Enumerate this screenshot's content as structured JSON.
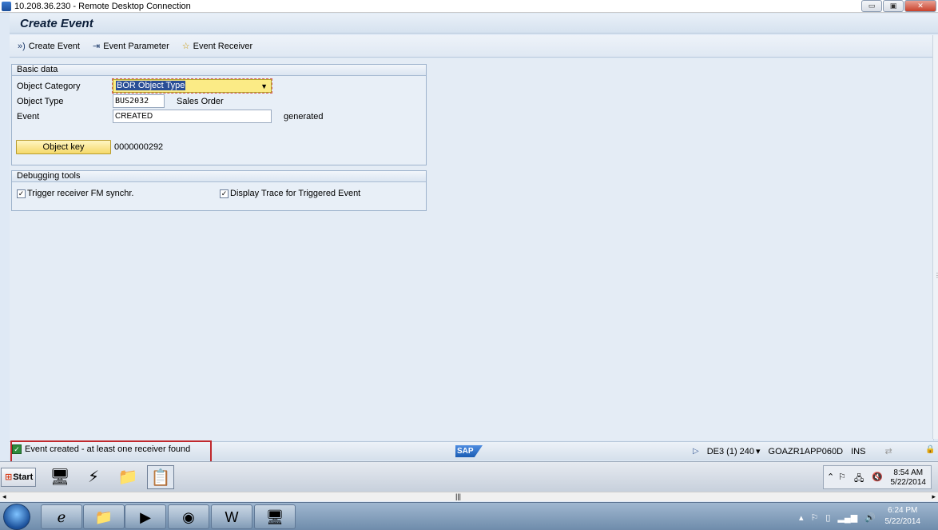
{
  "rdp": {
    "title": "10.208.36.230 - Remote Desktop Connection",
    "min": "▭",
    "restore": "▣",
    "close": "✕"
  },
  "sap": {
    "title": "Create Event",
    "toolbar": [
      {
        "label": "Create Event",
        "icon": "execute-icon",
        "glyph": "»)"
      },
      {
        "label": "Event Parameter",
        "icon": "parameter-icon",
        "glyph": "⇥"
      },
      {
        "label": "Event Receiver",
        "icon": "star-icon",
        "glyph": "☆"
      }
    ],
    "basic_data": {
      "header": "Basic data",
      "object_category_label": "Object Category",
      "object_category_value": "BOR Object Type",
      "object_type_label": "Object Type",
      "object_type_value": "BUS2032",
      "object_type_desc": "Sales Order",
      "event_label": "Event",
      "event_value": "CREATED",
      "event_status": "generated",
      "object_key_button": "Object key",
      "object_key_value": "0000000292"
    },
    "debugging": {
      "header": "Debugging tools",
      "trigger_label": "Trigger receiver FM synchr.",
      "trigger_checked": true,
      "trace_label": "Display Trace for Triggered Event",
      "trace_checked": true
    },
    "status": {
      "message": "Event created - at least one receiver found",
      "logo": "SAP",
      "system": "DE3 (1) 240",
      "server": "GOAZR1APP060D",
      "mode": "INS"
    }
  },
  "inner_taskbar": {
    "start": "Start",
    "time": "8:54 AM",
    "date": "5/22/2014"
  },
  "outer_taskbar": {
    "time": "6:24 PM",
    "date": "5/22/2014"
  },
  "hscroll": {
    "left": "◂",
    "mid": "|||",
    "right": "▸"
  }
}
